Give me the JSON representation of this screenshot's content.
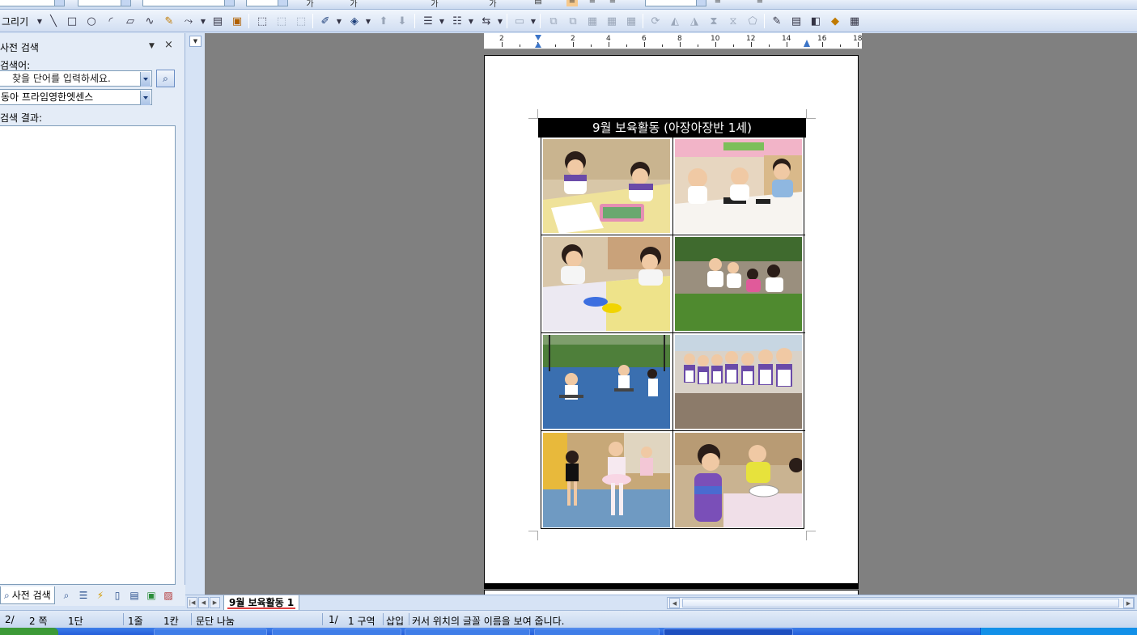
{
  "drawing_toolbar": {
    "label": "그리기"
  },
  "dictionary_panel": {
    "title": "사전 검색",
    "keyword_label": "검색어:",
    "search_placeholder": "찾을 단어를 입력하세요.",
    "dictionary_select": "동아 프라임영한엣센스",
    "result_label": "검색 결과:",
    "tab_label": "사전 검색"
  },
  "document": {
    "title": "9월 보육활동 (아장아장반 1세)",
    "photo_count": 8,
    "ruler_numbers": [
      "2",
      "2",
      "4",
      "6",
      "8",
      "10",
      "12",
      "14",
      "16",
      "18"
    ]
  },
  "tabs": {
    "document_tab": "9월 보육활동 1"
  },
  "status_bar": {
    "page": "2/",
    "total_pages": "2 쪽",
    "column_section": "1단",
    "line": "1줄",
    "column": "1칸",
    "paragraph": "문단 나눔",
    "section_position": "1/",
    "section": "1 구역",
    "mode": "삽입",
    "message": "커서 위치의 글꼴 이름을 보여 줍니다."
  },
  "colors": {
    "toolbar_bg": "#d6e3f5",
    "doc_bg": "#808080",
    "title_bar_bg": "#000000"
  }
}
